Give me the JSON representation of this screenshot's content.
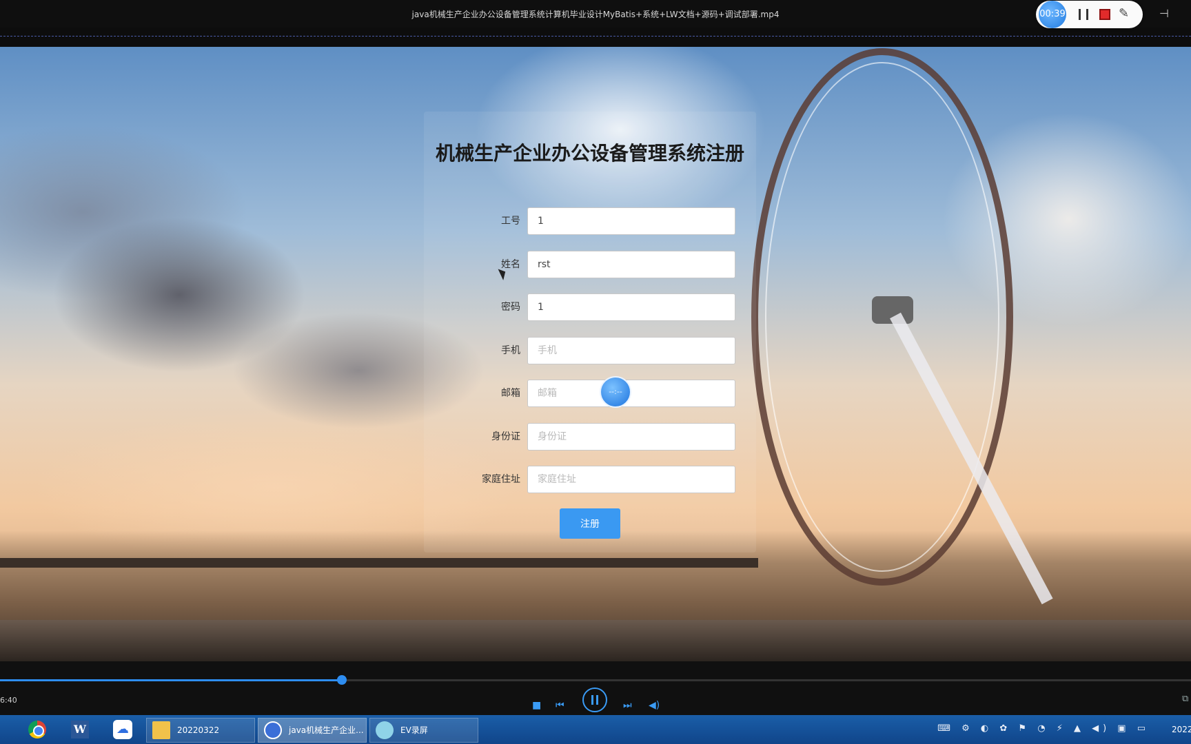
{
  "window": {
    "title": "java机械生产企业办公设备管理系统计算机毕业设计MyBatis+系统+LW文档+源码+调试部署.mp4"
  },
  "recorder": {
    "time": "00:39"
  },
  "form": {
    "title": "机械生产企业办公设备管理系统注册",
    "fields": [
      {
        "label": "工号",
        "value": "1",
        "placeholder": ""
      },
      {
        "label": "姓名",
        "value": "rst",
        "placeholder": ""
      },
      {
        "label": "密码",
        "value": "1",
        "placeholder": ""
      },
      {
        "label": "手机",
        "value": "",
        "placeholder": "手机"
      },
      {
        "label": "邮箱",
        "value": "",
        "placeholder": "邮箱"
      },
      {
        "label": "身份证",
        "value": "",
        "placeholder": "身份证"
      },
      {
        "label": "家庭住址",
        "value": "",
        "placeholder": "家庭住址"
      }
    ],
    "submit_label": "注册"
  },
  "buffering": {
    "text": "--:--"
  },
  "player": {
    "elapsed": "6:40",
    "progress": 0.287,
    "accent": "#2e8df0"
  },
  "taskbar": {
    "apps": [
      "chrome-icon",
      "word-icon",
      "baidu-netdisk-icon"
    ],
    "windows": [
      {
        "label": "20220322",
        "icon": "folder-icon"
      },
      {
        "label": "java机械生产企业...",
        "icon": "video-player-icon"
      },
      {
        "label": "EV录屏",
        "icon": "ev-recorder-icon"
      }
    ],
    "clock": "2022"
  }
}
